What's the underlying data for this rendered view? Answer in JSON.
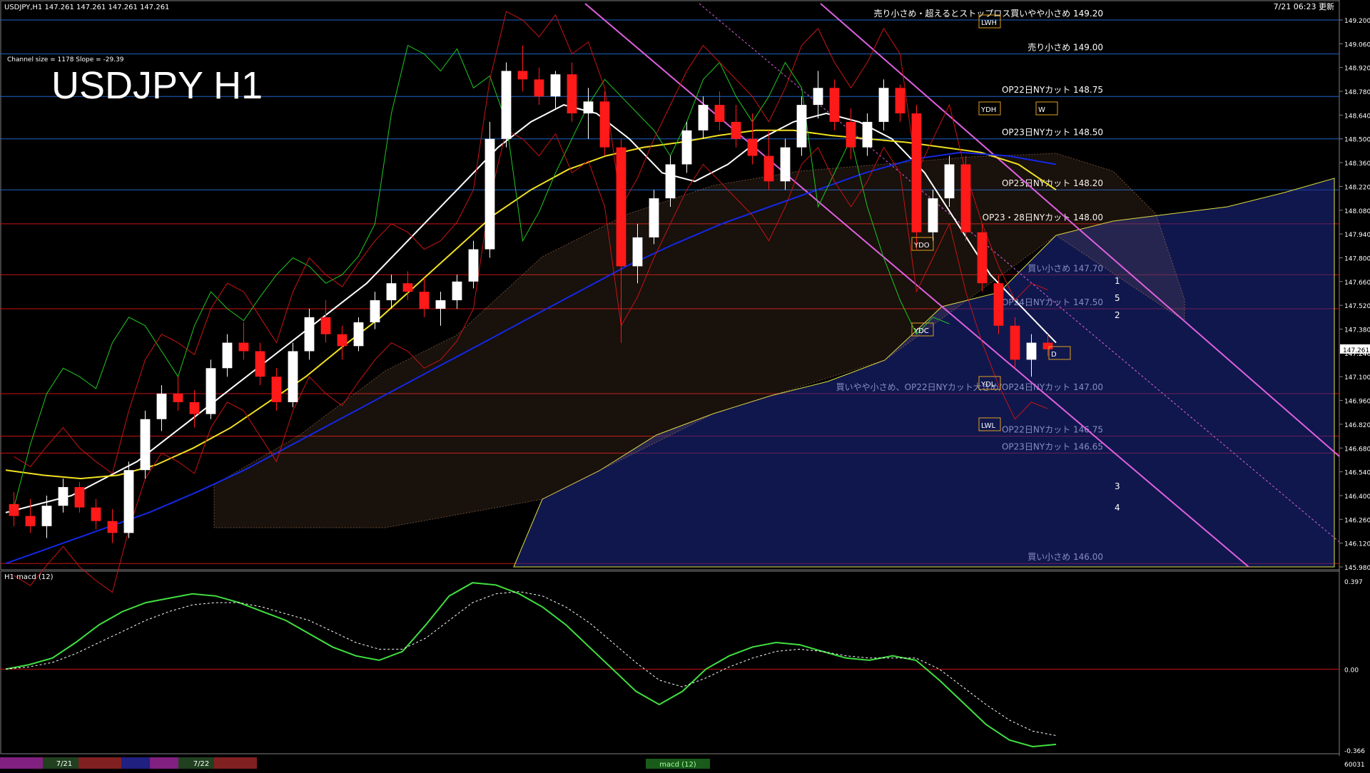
{
  "header": {
    "symbol_info": "USDJPY,H1  147.261 147.261 147.261 147.261",
    "channel_info": "Channel size = 1178 Slope = -29.39",
    "timestamp": "7/21 06:23 更新"
  },
  "watermark_title": "USDJPY H1",
  "colors": {
    "background": "#000000",
    "grid_blue": "#1e64c8",
    "grid_red": "#c81414",
    "bull_candle": "#ffffff",
    "bear_candle": "#ff1a1a",
    "ma_white": "#ffffff",
    "ma_yellow": "#f0e020",
    "ma_blue": "#1428e6",
    "bollinger": "#c81414",
    "chikou_green": "#20c820",
    "channel_magenta": "#e060e0",
    "cloud_blue": "#1e2a8c",
    "cloud_copper": "#c88c64",
    "macd_up": "#40e040",
    "macd_down": "#ff7090"
  },
  "chart_data": {
    "type": "candlestick",
    "symbol": "USDJPY",
    "timeframe": "H1",
    "ylim": [
      145.98,
      149.2
    ],
    "y_ticks": [
      "149.200",
      "149.060",
      "148.920",
      "148.780",
      "148.640",
      "148.500",
      "148.360",
      "148.220",
      "148.080",
      "147.940",
      "147.800",
      "147.660",
      "147.520",
      "147.380",
      "147.240",
      "147.100",
      "146.960",
      "146.820",
      "146.680",
      "146.540",
      "146.400",
      "146.260",
      "146.120",
      "145.980"
    ],
    "current_price": "147.261",
    "current_price_value": 147.261,
    "candles": [
      [
        146.35,
        146.42,
        146.22,
        146.28
      ],
      [
        146.28,
        146.38,
        146.18,
        146.22
      ],
      [
        146.22,
        146.4,
        146.15,
        146.34
      ],
      [
        146.34,
        146.5,
        146.3,
        146.45
      ],
      [
        146.45,
        146.48,
        146.3,
        146.33
      ],
      [
        146.33,
        146.38,
        146.2,
        146.25
      ],
      [
        146.25,
        146.32,
        146.12,
        146.18
      ],
      [
        146.18,
        146.6,
        146.15,
        146.55
      ],
      [
        146.55,
        146.9,
        146.5,
        146.85
      ],
      [
        146.85,
        147.05,
        146.78,
        147.0
      ],
      [
        147.0,
        147.1,
        146.9,
        146.95
      ],
      [
        146.95,
        147.02,
        146.8,
        146.88
      ],
      [
        146.88,
        147.2,
        146.85,
        147.15
      ],
      [
        147.15,
        147.35,
        147.1,
        147.3
      ],
      [
        147.3,
        147.42,
        147.2,
        147.25
      ],
      [
        147.25,
        147.3,
        147.05,
        147.1
      ],
      [
        147.1,
        147.15,
        146.9,
        146.95
      ],
      [
        146.95,
        147.3,
        146.92,
        147.25
      ],
      [
        147.25,
        147.5,
        147.2,
        147.45
      ],
      [
        147.45,
        147.55,
        147.3,
        147.35
      ],
      [
        147.35,
        147.4,
        147.2,
        147.28
      ],
      [
        147.28,
        147.45,
        147.25,
        147.42
      ],
      [
        147.42,
        147.6,
        147.38,
        147.55
      ],
      [
        147.55,
        147.7,
        147.5,
        147.65
      ],
      [
        147.65,
        147.72,
        147.55,
        147.6
      ],
      [
        147.6,
        147.68,
        147.45,
        147.5
      ],
      [
        147.5,
        147.6,
        147.4,
        147.55
      ],
      [
        147.55,
        147.7,
        147.5,
        147.66
      ],
      [
        147.66,
        147.9,
        147.62,
        147.85
      ],
      [
        147.85,
        148.6,
        147.8,
        148.5
      ],
      [
        148.5,
        148.95,
        148.45,
        148.9
      ],
      [
        148.9,
        149.05,
        148.78,
        148.85
      ],
      [
        148.85,
        148.92,
        148.7,
        148.75
      ],
      [
        148.75,
        148.9,
        148.68,
        148.88
      ],
      [
        148.88,
        148.95,
        148.6,
        148.65
      ],
      [
        148.65,
        148.8,
        148.5,
        148.72
      ],
      [
        148.72,
        148.78,
        148.4,
        148.45
      ],
      [
        148.45,
        148.5,
        147.3,
        147.75
      ],
      [
        147.75,
        148.0,
        147.65,
        147.92
      ],
      [
        147.92,
        148.2,
        147.88,
        148.15
      ],
      [
        148.15,
        148.4,
        148.1,
        148.35
      ],
      [
        148.35,
        148.6,
        148.3,
        148.55
      ],
      [
        148.55,
        148.75,
        148.5,
        148.7
      ],
      [
        148.7,
        148.78,
        148.55,
        148.6
      ],
      [
        148.6,
        148.7,
        148.45,
        148.5
      ],
      [
        148.5,
        148.65,
        148.35,
        148.4
      ],
      [
        148.4,
        148.55,
        148.2,
        148.25
      ],
      [
        148.25,
        148.5,
        148.2,
        148.45
      ],
      [
        148.45,
        148.75,
        148.4,
        148.7
      ],
      [
        148.7,
        148.9,
        148.62,
        148.8
      ],
      [
        148.8,
        148.85,
        148.55,
        148.6
      ],
      [
        148.6,
        148.68,
        148.38,
        148.45
      ],
      [
        148.45,
        148.65,
        148.4,
        148.6
      ],
      [
        148.6,
        148.85,
        148.55,
        148.8
      ],
      [
        148.8,
        148.82,
        148.6,
        148.65
      ],
      [
        148.65,
        148.7,
        147.85,
        147.95
      ],
      [
        147.95,
        148.2,
        147.9,
        148.15
      ],
      [
        148.15,
        148.4,
        148.1,
        148.35
      ],
      [
        148.35,
        148.4,
        147.9,
        147.95
      ],
      [
        147.95,
        148.0,
        147.6,
        147.65
      ],
      [
        147.65,
        147.7,
        147.35,
        147.4
      ],
      [
        147.4,
        147.45,
        147.15,
        147.2
      ],
      [
        147.2,
        147.35,
        147.1,
        147.3
      ],
      [
        147.3,
        147.35,
        147.22,
        147.261
      ]
    ],
    "moving_averages": [
      {
        "color_key": "ma_white",
        "values": [
          146.3,
          146.35,
          146.4,
          146.5,
          146.6,
          146.75,
          146.9,
          147.05,
          147.2,
          147.35,
          147.5,
          147.65,
          147.85,
          148.05,
          148.25,
          148.45,
          148.6,
          148.7,
          148.65,
          148.5,
          148.3,
          148.25,
          148.35,
          148.5,
          148.6,
          148.65,
          148.6,
          148.5,
          148.3,
          148.0,
          147.7,
          147.5,
          147.3
        ]
      },
      {
        "color_key": "ma_yellow",
        "values": [
          146.55,
          146.52,
          146.5,
          146.52,
          146.58,
          146.68,
          146.8,
          146.95,
          147.1,
          147.28,
          147.45,
          147.65,
          147.85,
          148.05,
          148.2,
          148.32,
          148.4,
          148.45,
          148.48,
          148.52,
          148.55,
          148.55,
          148.52,
          148.5,
          148.48,
          148.45,
          148.42,
          148.35,
          148.2
        ]
      },
      {
        "color_key": "ma_blue",
        "values": [
          146.0,
          146.1,
          146.2,
          146.3,
          146.42,
          146.55,
          146.7,
          146.85,
          147.0,
          147.15,
          147.3,
          147.45,
          147.6,
          147.75,
          147.88,
          148.0,
          148.1,
          148.2,
          148.3,
          148.38,
          148.42,
          148.4,
          148.35
        ]
      }
    ],
    "levels": [
      {
        "label": "売り小さめ・超えるとストップロス買いやや小さめ 149.20",
        "value": 149.2,
        "color_key": "grid_blue"
      },
      {
        "label": "売り小さめ 149.00",
        "value": 149.0,
        "color_key": "grid_blue"
      },
      {
        "label": "OP22日NYカット 148.75",
        "value": 148.75,
        "color_key": "grid_blue"
      },
      {
        "label": "OP23日NYカット 148.50",
        "value": 148.5,
        "color_key": "grid_blue"
      },
      {
        "label": "OP23日NYカット 148.20",
        "value": 148.2,
        "color_key": "grid_blue"
      },
      {
        "label": "OP23・28日NYカット 148.00",
        "value": 148.0,
        "color_key": "grid_red"
      },
      {
        "label": "買い小さめ 147.70",
        "value": 147.7,
        "color_key": "grid_red"
      },
      {
        "label": "OP24日NYカット 147.50",
        "value": 147.5,
        "color_key": "grid_red"
      },
      {
        "label": "買いやや小さめ、OP22日NYカット大きめ/OP24日NYカット 147.00",
        "value": 147.0,
        "color_key": "grid_red"
      },
      {
        "label": "OP22日NYカット 146.75",
        "value": 146.75,
        "color_key": "grid_red"
      },
      {
        "label": "OP23日NYカット 146.65",
        "value": 146.65,
        "color_key": "grid_red"
      },
      {
        "label": "買い小さめ 146.00",
        "value": 146.0,
        "color_key": "grid_red"
      }
    ],
    "box_labels": [
      "YDO",
      "YDC",
      "YDH",
      "YDL",
      "LWH",
      "LWL",
      "W",
      "D"
    ],
    "wave_labels": [
      "1",
      "5",
      "2",
      "3",
      "4"
    ]
  },
  "macd_panel": {
    "title": "H1  macd (12)",
    "y_ticks": [
      "0.397",
      "0.00",
      "-0.366"
    ],
    "ylim": [
      -0.366,
      0.397
    ],
    "main": [
      0.0,
      0.02,
      0.05,
      0.12,
      0.2,
      0.26,
      0.3,
      0.32,
      0.34,
      0.33,
      0.3,
      0.26,
      0.22,
      0.16,
      0.1,
      0.06,
      0.04,
      0.08,
      0.2,
      0.33,
      0.39,
      0.38,
      0.34,
      0.28,
      0.2,
      0.1,
      0.0,
      -0.1,
      -0.16,
      -0.1,
      0.0,
      0.06,
      0.1,
      0.12,
      0.11,
      0.08,
      0.05,
      0.04,
      0.06,
      0.04,
      -0.05,
      -0.15,
      -0.25,
      -0.32,
      -0.35,
      -0.34
    ],
    "signal": [
      0.0,
      0.01,
      0.03,
      0.07,
      0.12,
      0.17,
      0.22,
      0.26,
      0.29,
      0.3,
      0.3,
      0.28,
      0.25,
      0.22,
      0.17,
      0.12,
      0.09,
      0.09,
      0.14,
      0.22,
      0.3,
      0.34,
      0.35,
      0.33,
      0.28,
      0.21,
      0.12,
      0.03,
      -0.05,
      -0.08,
      -0.04,
      0.01,
      0.05,
      0.08,
      0.09,
      0.08,
      0.06,
      0.05,
      0.05,
      0.05,
      0.0,
      -0.08,
      -0.16,
      -0.23,
      -0.28,
      -0.3
    ]
  },
  "time_axis": {
    "labels": [
      "7/21",
      "7/22"
    ],
    "status": "macd (12)",
    "right_value": "60031"
  }
}
